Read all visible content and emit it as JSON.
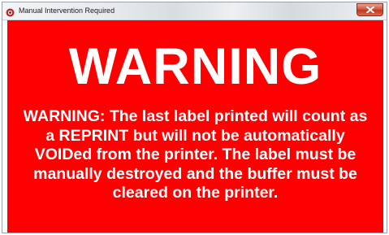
{
  "window": {
    "title": "Manual Intervention Required",
    "icon": "app-icon",
    "close_icon": "close-icon"
  },
  "colors": {
    "background": "#ff0000",
    "text": "#ffffff",
    "close_button": "#c7402a"
  },
  "main": {
    "heading": "WARNING",
    "message": "WARNING: The last label printed will count as a REPRINT but will not be automatically VOIDed from the printer. The label must be manually destroyed and the buffer must be cleared on the printer."
  }
}
